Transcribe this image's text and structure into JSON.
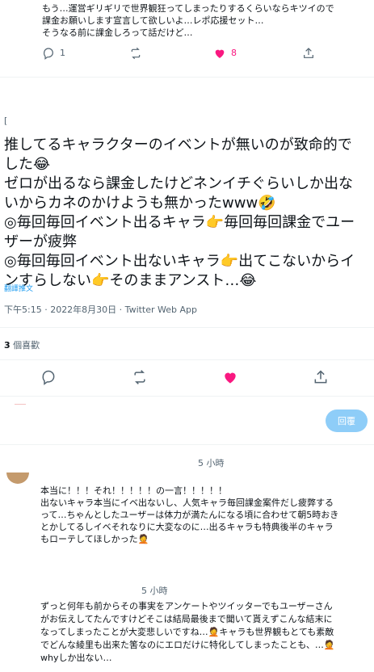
{
  "top_reply": {
    "lines": [
      "もう…運営ギリギリで世界観狂ってしまったりするくらいならキツイので",
      "課金お願いします宣言して欲しいよ…レポ応援セット…",
      "そうなる前に課金しろって話だけど…"
    ],
    "reply_count": "1",
    "like_count": "8"
  },
  "main_tweet": {
    "avatar_fragment": "[",
    "lines": [
      "推してるキャラクターのイベントが無いのが致命的で",
      "した😂",
      "ゼロが出るなら課金したけどネンイチぐらいしか出な",
      "いからカネのかけようも無かったwww🤣",
      "◎毎回毎回イベント出るキャラ👉毎回毎回課金でユー",
      "ザーが疲弊",
      "◎毎回毎回イベント出ないキャラ👉出てこないからイ",
      "ンすらしない👉そのままアンスト…😂"
    ],
    "translate_link": "翻譯推文",
    "timestamp": "下午5:15 · 2022年8月30日 · Twitter Web App",
    "likes_count": "3",
    "likes_label": "個喜歡"
  },
  "compose": {
    "reply_button": "回覆"
  },
  "reply1": {
    "time": "5 小時",
    "lines": [
      "本当に！！！それ！！！！！の一言！！！！！",
      "出ないキャラ本当にイベ出ないし、人気キャラ毎回課金案件だし疲弊する",
      "って…ちゃんとしたユーザーは体力が満たんになる頃に合わせて朝5時おき",
      "とかしてるしイベそれなりに大変なのに…出るキャラも特典後半のキャラ",
      "もローテしてほしかった🤦"
    ]
  },
  "reply2": {
    "time": "5 小時",
    "lines": [
      "ずっと何年も前からその事実をアンケートやツイッターでもユーザーさん",
      "がお伝えしてたんですけどそこは結局最後まで聞いて貰えずこんな結末に",
      "なってしまったことが大変悲しいですね…🤦キャラも世界観もとても素敵",
      "でどんな綾里も出来た筈なのにエロだけに特化してしまったことも、…🤦",
      "whyしか出ない…"
    ]
  },
  "colors": {
    "like_pink": "#f91880",
    "reply_button_bg": "#8ecdf8",
    "muted_text": "#536471",
    "link": "#1d9bf0"
  }
}
